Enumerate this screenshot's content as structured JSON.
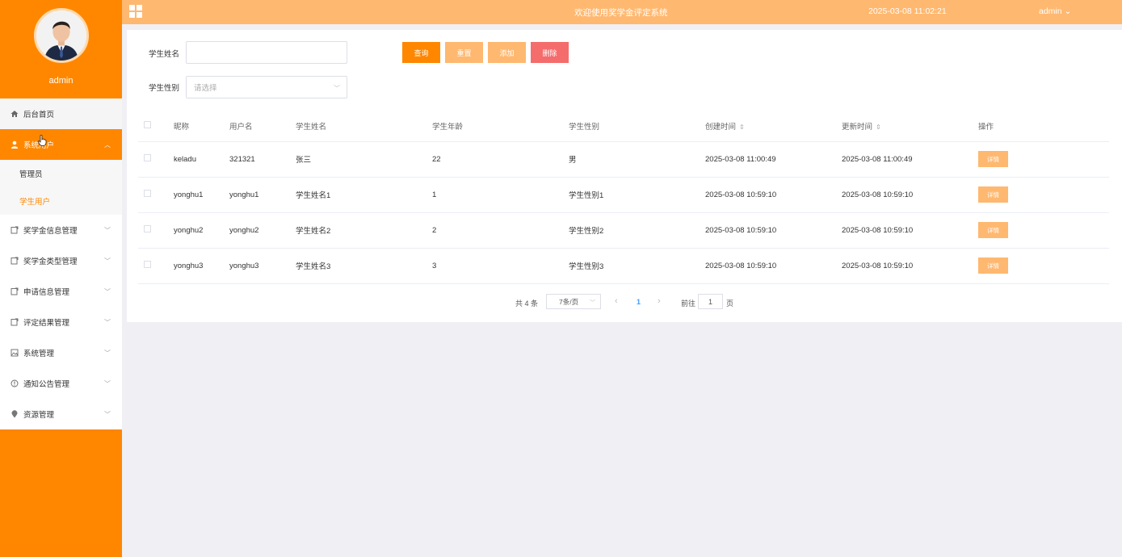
{
  "header": {
    "title": "欢迎使用奖学金评定系统",
    "datetime": "2025-03-08 11:02:21",
    "user": "admin",
    "user_caret": "⌄"
  },
  "profile": {
    "name": "admin"
  },
  "menu": {
    "home": "后台首页",
    "system_users": "系统用户",
    "sub": [
      "管理员",
      "学生用户"
    ],
    "items": [
      "奖学金信息管理",
      "奖学金类型管理",
      "申请信息管理",
      "评定结果管理",
      "系统管理",
      "通知公告管理",
      "资源管理"
    ]
  },
  "search": {
    "name_label": "学生姓名",
    "name_value": "",
    "gender_label": "学生性别",
    "gender_placeholder": "请选择"
  },
  "buttons": {
    "query": "查询",
    "reset": "重置",
    "add": "添加",
    "delete": "删除"
  },
  "colors": {
    "primary": "#ff8700",
    "light": "#ffb870",
    "danger": "#f56c6c"
  },
  "table": {
    "headers": [
      "昵称",
      "用户名",
      "学生姓名",
      "学生年龄",
      "学生性别",
      "创建时间",
      "更新时间",
      "操作"
    ],
    "sort_icon": "⇕",
    "detail_label": "详情",
    "rows": [
      [
        "keladu",
        "321321",
        "张三",
        "22",
        "男",
        "2025-03-08 11:00:49",
        "2025-03-08 11:00:49"
      ],
      [
        "yonghu1",
        "yonghu1",
        "学生姓名1",
        "1",
        "学生性别1",
        "2025-03-08 10:59:10",
        "2025-03-08 10:59:10"
      ],
      [
        "yonghu2",
        "yonghu2",
        "学生姓名2",
        "2",
        "学生性别2",
        "2025-03-08 10:59:10",
        "2025-03-08 10:59:10"
      ],
      [
        "yonghu3",
        "yonghu3",
        "学生姓名3",
        "3",
        "学生性别3",
        "2025-03-08 10:59:10",
        "2025-03-08 10:59:10"
      ]
    ]
  },
  "pager": {
    "total": "共 4 条",
    "page_size": "7条/页",
    "prev": "‹",
    "current": "1",
    "next": "›",
    "goto_label": "前往",
    "goto_value": "1",
    "page_unit": "页"
  }
}
